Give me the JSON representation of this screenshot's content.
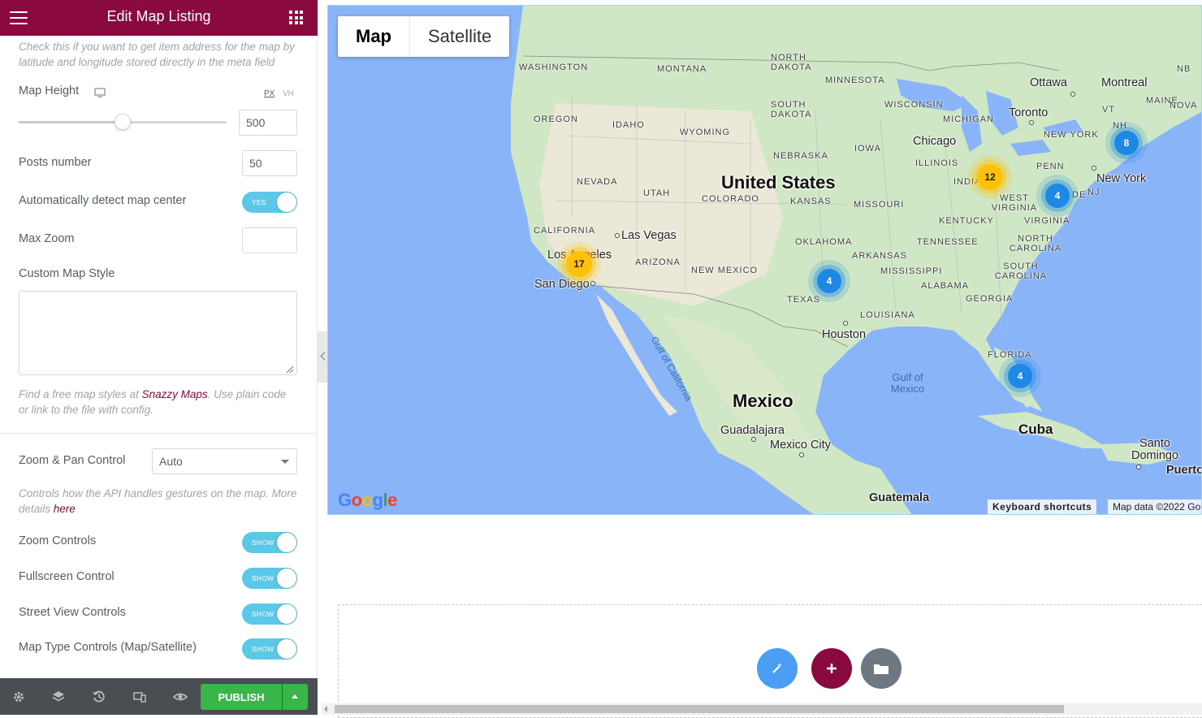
{
  "header": {
    "title": "Edit Map Listing"
  },
  "settings": {
    "meta_help": "Check this if you want to get item address for the map by latitude and longitude stored directly in the meta field",
    "map_height": {
      "label": "Map Height",
      "unit_px": "PX",
      "unit_vh": "VH",
      "value": "500",
      "slider_fraction": 0.5
    },
    "posts_number": {
      "label": "Posts number",
      "value": "50"
    },
    "auto_center": {
      "label": "Automatically detect map center",
      "state": "YES"
    },
    "max_zoom": {
      "label": "Max Zoom",
      "value": ""
    },
    "custom_style": {
      "label": "Custom Map Style",
      "value": ""
    },
    "style_help_pre": "Find a free map styles at ",
    "style_help_link": "Snazzy Maps",
    "style_help_post": ". Use plain code or link to the file with config.",
    "zoom_pan": {
      "label": "Zoom & Pan Control",
      "value": "Auto"
    },
    "gesture_help_pre": "Controls how the API handles gestures on the map. More details ",
    "gesture_help_link": "here",
    "zoom_controls": {
      "label": "Zoom Controls",
      "state": "SHOW"
    },
    "fullscreen": {
      "label": "Fullscreen Control",
      "state": "SHOW"
    },
    "street_view": {
      "label": "Street View Controls",
      "state": "SHOW"
    },
    "map_type": {
      "label": "Map Type Controls (Map/Satellite)",
      "state": "SHOW"
    }
  },
  "footer": {
    "publish_label": "PUBLISH"
  },
  "map": {
    "tabs": [
      "Map",
      "Satellite"
    ],
    "states": [
      "WASHINGTON",
      "MONTANA",
      "NORTH DAKOTA",
      "MINNESOTA",
      "SOUTH DAKOTA",
      "WISCONSIN",
      "MICHIGAN",
      "OREGON",
      "IDAHO",
      "WYOMING",
      "NEBRASKA",
      "IOWA",
      "ILLINOIS",
      "INDIANA",
      "NEVADA",
      "UTAH",
      "COLORADO",
      "KANSAS",
      "MISSOURI",
      "CALIFORNIA",
      "ARIZONA",
      "NEW MEXICO",
      "OKLAHOMA",
      "ARKANSAS",
      "TENNESSEE",
      "KENTUCKY",
      "VIRGINIA",
      "WEST VIRGINIA",
      "PENN",
      "NEW YORK",
      "MAINE",
      "NH",
      "VT",
      "NJ",
      "DE",
      "NORTH CAROLINA",
      "SOUTH CAROLINA",
      "MISSISSIPPI",
      "ALABAMA",
      "GEORGIA",
      "TEXAS",
      "LOUISIANA",
      "FLORIDA",
      "NB",
      "NOVA"
    ],
    "cities": [
      "Ottawa",
      "Montreal",
      "Toronto",
      "Chicago",
      "New York",
      "Las Vegas",
      "Los Angeles",
      "San Diego",
      "Houston",
      "Guadalajara",
      "Mexico City",
      "Guatemala",
      "Santo Domingo",
      "Puerto"
    ],
    "countries": [
      "United States",
      "Mexico",
      "Cuba"
    ],
    "water": "Gulf of Mexico",
    "gulf_california": "Gulf of California",
    "clusters": [
      {
        "count": "17",
        "color": "yellow"
      },
      {
        "count": "12",
        "color": "yellow"
      },
      {
        "count": "8",
        "color": "blue"
      },
      {
        "count": "4",
        "color": "blue"
      },
      {
        "count": "4",
        "color": "blue"
      },
      {
        "count": "4",
        "color": "blue"
      }
    ],
    "logo": "Google",
    "keyboard_shortcuts": "Keyboard shortcuts",
    "map_data": "Map data ©2022 Go"
  },
  "colors": {
    "brand": "#8b0a3d",
    "toggle": "#5bc8e8",
    "publish": "#39b54a",
    "fab_blue": "#4a9ff5",
    "fab_gray": "#6d7882"
  }
}
